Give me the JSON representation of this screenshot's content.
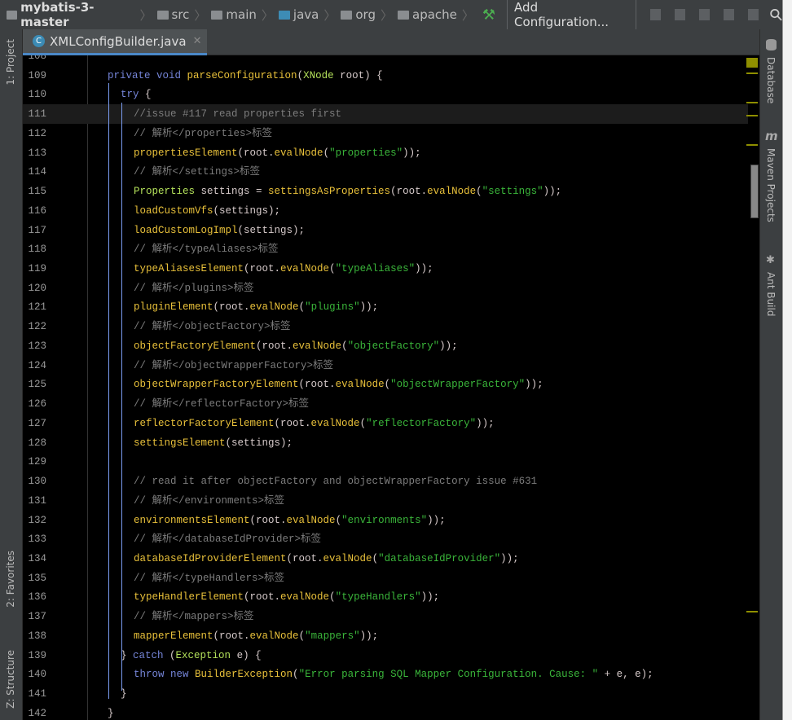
{
  "breadcrumb": [
    {
      "label": "mybatis-3-master",
      "icon": "project-icon"
    },
    {
      "label": "src",
      "icon": "folder-icon"
    },
    {
      "label": "main",
      "icon": "folder-icon"
    },
    {
      "label": "java",
      "icon": "source-folder-icon"
    },
    {
      "label": "org",
      "icon": "package-icon"
    },
    {
      "label": "apache",
      "icon": "package-icon"
    }
  ],
  "toolbar": {
    "add_configuration": "Add Configuration..."
  },
  "tab": {
    "label": "XMLConfigBuilder.java",
    "icon_letter": "C"
  },
  "left_tools": {
    "project": "1: Project",
    "favorites": "2: Favorites",
    "structure": "Z: Structure"
  },
  "right_tools": {
    "database": "Database",
    "maven": "Maven Projects",
    "ant": "Ant Build",
    "maven_glyph": "m"
  },
  "colors": {
    "keyword": "#7585d8",
    "method": "#e8c03a",
    "type": "#b3e05a",
    "string": "#3ab53a",
    "comment": "#7c7c7c",
    "text": "#d6caca",
    "accent": "#4a88c7"
  },
  "current_line": 111,
  "lines": [
    {
      "n": "108",
      "i": 0,
      "t": []
    },
    {
      "n": "109",
      "i": 1,
      "t": [
        [
          "kw",
          "private void "
        ],
        [
          "fn",
          "parseConfiguration"
        ],
        [
          "tx",
          "("
        ],
        [
          "ty",
          "XNode"
        ],
        [
          "tx",
          " root) {"
        ]
      ]
    },
    {
      "n": "110",
      "i": 2,
      "t": [
        [
          "kw",
          "try"
        ],
        [
          "tx",
          " {"
        ]
      ]
    },
    {
      "n": "111",
      "i": 3,
      "t": [
        [
          "cm",
          "//issue #117 read properties first"
        ]
      ]
    },
    {
      "n": "112",
      "i": 3,
      "t": [
        [
          "cm",
          "// 解析</properties>标签"
        ]
      ]
    },
    {
      "n": "113",
      "i": 3,
      "t": [
        [
          "fn",
          "propertiesElement"
        ],
        [
          "tx",
          "(root."
        ],
        [
          "fn",
          "evalNode"
        ],
        [
          "tx",
          "("
        ],
        [
          "st",
          "\"properties\""
        ],
        [
          "tx",
          "));"
        ]
      ]
    },
    {
      "n": "114",
      "i": 3,
      "t": [
        [
          "cm",
          "// 解析</settings>标签"
        ]
      ]
    },
    {
      "n": "115",
      "i": 3,
      "t": [
        [
          "ty",
          "Properties"
        ],
        [
          "tx",
          " settings = "
        ],
        [
          "fn",
          "settingsAsProperties"
        ],
        [
          "tx",
          "(root."
        ],
        [
          "fn",
          "evalNode"
        ],
        [
          "tx",
          "("
        ],
        [
          "st",
          "\"settings\""
        ],
        [
          "tx",
          "));"
        ]
      ]
    },
    {
      "n": "116",
      "i": 3,
      "t": [
        [
          "fn",
          "loadCustomVfs"
        ],
        [
          "tx",
          "(settings);"
        ]
      ]
    },
    {
      "n": "117",
      "i": 3,
      "t": [
        [
          "fn",
          "loadCustomLogImpl"
        ],
        [
          "tx",
          "(settings);"
        ]
      ]
    },
    {
      "n": "118",
      "i": 3,
      "t": [
        [
          "cm",
          "// 解析</typeAliases>标签"
        ]
      ]
    },
    {
      "n": "119",
      "i": 3,
      "t": [
        [
          "fn",
          "typeAliasesElement"
        ],
        [
          "tx",
          "(root."
        ],
        [
          "fn",
          "evalNode"
        ],
        [
          "tx",
          "("
        ],
        [
          "st",
          "\"typeAliases\""
        ],
        [
          "tx",
          "));"
        ]
      ]
    },
    {
      "n": "120",
      "i": 3,
      "t": [
        [
          "cm",
          "// 解析</plugins>标签"
        ]
      ]
    },
    {
      "n": "121",
      "i": 3,
      "t": [
        [
          "fn",
          "pluginElement"
        ],
        [
          "tx",
          "(root."
        ],
        [
          "fn",
          "evalNode"
        ],
        [
          "tx",
          "("
        ],
        [
          "st",
          "\"plugins\""
        ],
        [
          "tx",
          "));"
        ]
      ]
    },
    {
      "n": "122",
      "i": 3,
      "t": [
        [
          "cm",
          "// 解析</objectFactory>标签"
        ]
      ]
    },
    {
      "n": "123",
      "i": 3,
      "t": [
        [
          "fn",
          "objectFactoryElement"
        ],
        [
          "tx",
          "(root."
        ],
        [
          "fn",
          "evalNode"
        ],
        [
          "tx",
          "("
        ],
        [
          "st",
          "\"objectFactory\""
        ],
        [
          "tx",
          "));"
        ]
      ]
    },
    {
      "n": "124",
      "i": 3,
      "t": [
        [
          "cm",
          "// 解析</objectWrapperFactory>标签"
        ]
      ]
    },
    {
      "n": "125",
      "i": 3,
      "t": [
        [
          "fn",
          "objectWrapperFactoryElement"
        ],
        [
          "tx",
          "(root."
        ],
        [
          "fn",
          "evalNode"
        ],
        [
          "tx",
          "("
        ],
        [
          "st",
          "\"objectWrapperFactory\""
        ],
        [
          "tx",
          "));"
        ]
      ]
    },
    {
      "n": "126",
      "i": 3,
      "t": [
        [
          "cm",
          "// 解析</reflectorFactory>标签"
        ]
      ]
    },
    {
      "n": "127",
      "i": 3,
      "t": [
        [
          "fn",
          "reflectorFactoryElement"
        ],
        [
          "tx",
          "(root."
        ],
        [
          "fn",
          "evalNode"
        ],
        [
          "tx",
          "("
        ],
        [
          "st",
          "\"reflectorFactory\""
        ],
        [
          "tx",
          "));"
        ]
      ]
    },
    {
      "n": "128",
      "i": 3,
      "t": [
        [
          "fn",
          "settingsElement"
        ],
        [
          "tx",
          "(settings);"
        ]
      ]
    },
    {
      "n": "129",
      "i": 3,
      "t": []
    },
    {
      "n": "130",
      "i": 3,
      "t": [
        [
          "cm",
          "// read it after objectFactory and objectWrapperFactory issue #631"
        ]
      ]
    },
    {
      "n": "131",
      "i": 3,
      "t": [
        [
          "cm",
          "// 解析</environments>标签"
        ]
      ]
    },
    {
      "n": "132",
      "i": 3,
      "t": [
        [
          "fn",
          "environmentsElement"
        ],
        [
          "tx",
          "(root."
        ],
        [
          "fn",
          "evalNode"
        ],
        [
          "tx",
          "("
        ],
        [
          "st",
          "\"environments\""
        ],
        [
          "tx",
          "));"
        ]
      ]
    },
    {
      "n": "133",
      "i": 3,
      "t": [
        [
          "cm",
          "// 解析</databaseIdProvider>标签"
        ]
      ]
    },
    {
      "n": "134",
      "i": 3,
      "t": [
        [
          "fn",
          "databaseIdProviderElement"
        ],
        [
          "tx",
          "(root."
        ],
        [
          "fn",
          "evalNode"
        ],
        [
          "tx",
          "("
        ],
        [
          "st",
          "\"databaseIdProvider\""
        ],
        [
          "tx",
          "));"
        ]
      ]
    },
    {
      "n": "135",
      "i": 3,
      "t": [
        [
          "cm",
          "// 解析</typeHandlers>标签"
        ]
      ]
    },
    {
      "n": "136",
      "i": 3,
      "t": [
        [
          "fn",
          "typeHandlerElement"
        ],
        [
          "tx",
          "(root."
        ],
        [
          "fn",
          "evalNode"
        ],
        [
          "tx",
          "("
        ],
        [
          "st",
          "\"typeHandlers\""
        ],
        [
          "tx",
          "));"
        ]
      ]
    },
    {
      "n": "137",
      "i": 3,
      "t": [
        [
          "cm",
          "// 解析</mappers>标签"
        ]
      ]
    },
    {
      "n": "138",
      "i": 3,
      "t": [
        [
          "fn",
          "mapperElement"
        ],
        [
          "tx",
          "(root."
        ],
        [
          "fn",
          "evalNode"
        ],
        [
          "tx",
          "("
        ],
        [
          "st",
          "\"mappers\""
        ],
        [
          "tx",
          "));"
        ]
      ]
    },
    {
      "n": "139",
      "i": 2,
      "t": [
        [
          "tx",
          "} "
        ],
        [
          "kw",
          "catch"
        ],
        [
          "tx",
          " ("
        ],
        [
          "ty",
          "Exception"
        ],
        [
          "tx",
          " e) {"
        ]
      ]
    },
    {
      "n": "140",
      "i": 3,
      "t": [
        [
          "kw",
          "throw new "
        ],
        [
          "fn",
          "BuilderException"
        ],
        [
          "tx",
          "("
        ],
        [
          "st",
          "\"Error parsing SQL Mapper Configuration. Cause: \""
        ],
        [
          "tx",
          " + e, e);"
        ]
      ]
    },
    {
      "n": "141",
      "i": 2,
      "t": [
        [
          "tx",
          "}"
        ]
      ]
    },
    {
      "n": "142",
      "i": 1,
      "t": [
        [
          "tx",
          "}"
        ]
      ]
    }
  ]
}
